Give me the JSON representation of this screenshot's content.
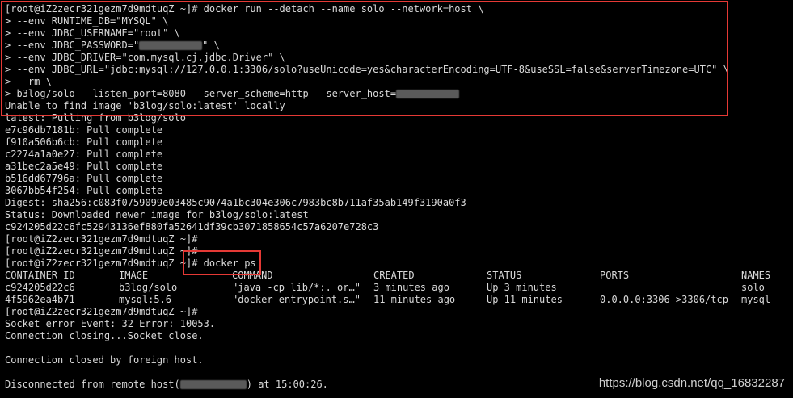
{
  "terminal": {
    "lines": [
      "[root@iZ2zecr321gezm7d9mdtuqZ ~]# docker run --detach --name solo --network=host \\",
      "> --env RUNTIME_DB=\"MYSQL\" \\",
      "> --env JDBC_USERNAME=\"root\" \\",
      "> --env JDBC_PASSWORD=\"",
      "> --env JDBC_DRIVER=\"com.mysql.cj.jdbc.Driver\" \\",
      "> --env JDBC_URL=\"jdbc:mysql://127.0.0.1:3306/solo?useUnicode=yes&characterEncoding=UTF-8&useSSL=false&serverTimezone=UTC\" \\",
      "> --rm \\",
      "> b3log/solo --listen_port=8080 --server_scheme=http --server_host=",
      "Unable to find image 'b3log/solo:latest' locally",
      "latest: Pulling from b3log/solo",
      "e7c96db7181b: Pull complete",
      "f910a506b6cb: Pull complete",
      "c2274a1a0e27: Pull complete",
      "a31bec2a5e49: Pull complete",
      "b516dd67796a: Pull complete",
      "3067bb54f254: Pull complete",
      "Digest: sha256:c083f0759099e03485c9074a1bc304e306c7983bc8b711af35ab149f3190a0f3",
      "Status: Downloaded newer image for b3log/solo:latest",
      "c924205d22c6fc52943136ef880fa52641df39cb3071858654c57a6207e728c3",
      "[root@iZ2zecr321gezm7d9mdtuqZ ~]#",
      "[root@iZ2zecr321gezm7d9mdtuqZ ~]#",
      "[root@iZ2zecr321gezm7d9mdtuqZ ~]# docker ps"
    ],
    "password_suffix": "\" \\",
    "ps_table": {
      "headers": [
        "CONTAINER ID",
        "IMAGE",
        "COMMAND",
        "CREATED",
        "STATUS",
        "PORTS",
        "NAMES"
      ],
      "rows": [
        [
          "c924205d22c6",
          "b3log/solo",
          "\"java -cp lib/*:. or…\"",
          "3 minutes ago",
          "Up 3 minutes",
          "",
          "solo"
        ],
        [
          "4f5962ea4b71",
          "mysql:5.6",
          "\"docker-entrypoint.s…\"",
          "11 minutes ago",
          "Up 11 minutes",
          "0.0.0.0:3306->3306/tcp",
          "mysql"
        ]
      ]
    },
    "after_lines": [
      "[root@iZ2zecr321gezm7d9mdtuqZ ~]#",
      "Socket error Event: 32 Error: 10053.",
      "Connection closing...Socket close.",
      "",
      "Connection closed by foreign host.",
      "",
      "Disconnected from remote host(",
      ") at 15:00:26."
    ]
  },
  "watermark": "https://blog.csdn.net/qq_16832287",
  "colors": {
    "background": "#000000",
    "text": "#d9d9d9",
    "highlight": "#e53935",
    "mask": "#5a5a5a"
  }
}
